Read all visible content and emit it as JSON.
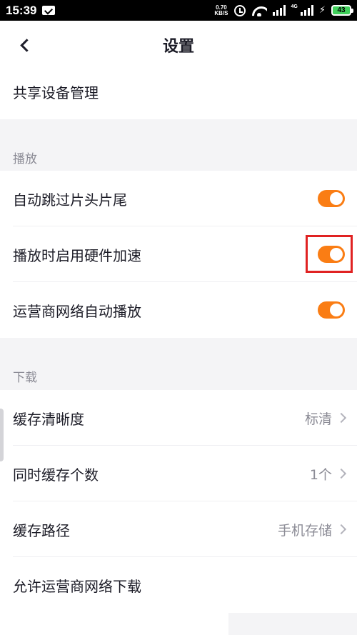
{
  "status_bar": {
    "time": "15:39",
    "net_speed_value": "0.70",
    "net_speed_unit": "KB/S",
    "network_type": "4G",
    "battery_level": "43"
  },
  "header": {
    "title": "设置"
  },
  "rows": {
    "shared_device": {
      "label": "共享设备管理"
    },
    "skip_intro": {
      "label": "自动跳过片头片尾",
      "enabled": true
    },
    "hw_accel": {
      "label": "播放时启用硬件加速",
      "enabled": true
    },
    "carrier_autoplay": {
      "label": "运营商网络自动播放",
      "enabled": true
    },
    "cache_quality": {
      "label": "缓存清晰度",
      "value": "标清"
    },
    "concurrent_cache": {
      "label": "同时缓存个数",
      "value": "1个"
    },
    "cache_path": {
      "label": "缓存路径",
      "value": "手机存储"
    },
    "carrier_download": {
      "label": "允许运营商网络下载"
    }
  },
  "sections": {
    "playback": "播放",
    "download": "下载"
  },
  "colors": {
    "accent": "#fa7d14",
    "highlight": "#e02222",
    "background": "#f4f4f6"
  }
}
